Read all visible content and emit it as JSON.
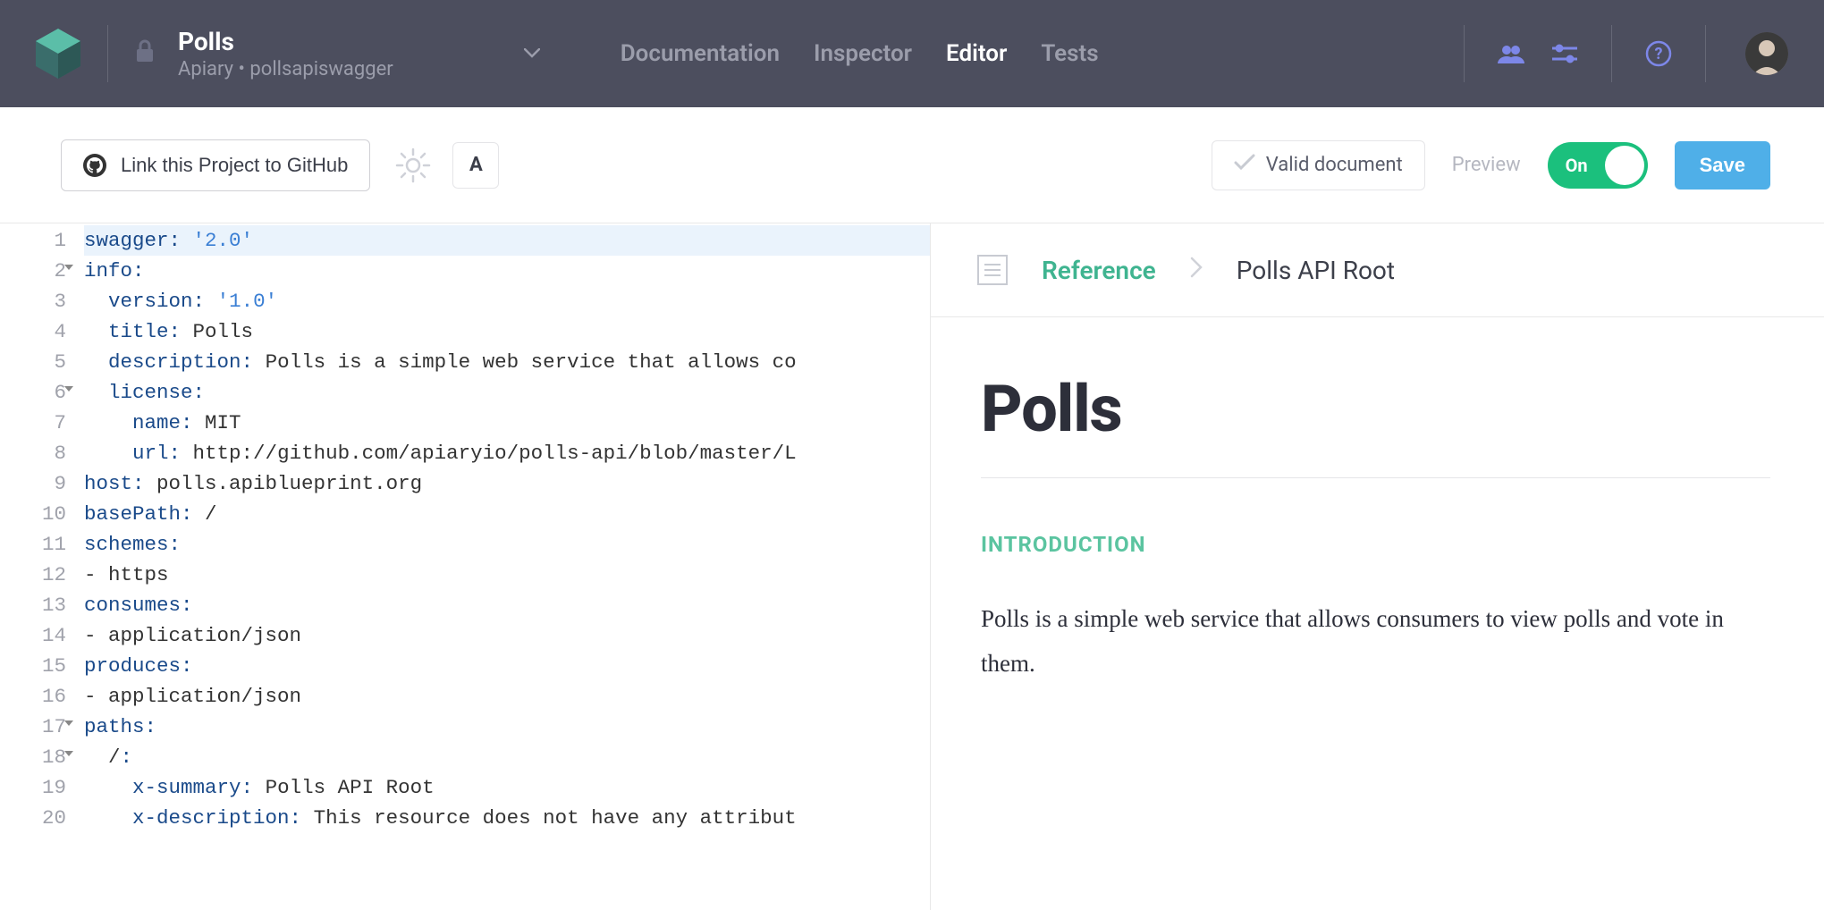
{
  "header": {
    "project_title": "Polls",
    "project_subtitle": "Apiary • pollsapiswagger",
    "tabs": [
      {
        "label": "Documentation",
        "active": false
      },
      {
        "label": "Inspector",
        "active": false
      },
      {
        "label": "Editor",
        "active": true
      },
      {
        "label": "Tests",
        "active": false
      }
    ]
  },
  "toolbar": {
    "github_label": "Link this Project to GitHub",
    "a_label": "A",
    "valid_label": "Valid document",
    "preview_label": "Preview",
    "toggle_label": "On",
    "save_label": "Save"
  },
  "editor": {
    "lines": [
      {
        "n": 1,
        "hl": true,
        "fold": false,
        "tokens": [
          [
            "key",
            "swagger"
          ],
          [
            "punct",
            ":"
          ],
          [
            "txt",
            " "
          ],
          [
            "str",
            "'2.0'"
          ]
        ]
      },
      {
        "n": 2,
        "fold": true,
        "tokens": [
          [
            "key",
            "info"
          ],
          [
            "punct",
            ":"
          ]
        ]
      },
      {
        "n": 3,
        "tokens": [
          [
            "txt",
            "  "
          ],
          [
            "key",
            "version"
          ],
          [
            "punct",
            ":"
          ],
          [
            "txt",
            " "
          ],
          [
            "str",
            "'1.0'"
          ]
        ]
      },
      {
        "n": 4,
        "tokens": [
          [
            "txt",
            "  "
          ],
          [
            "key",
            "title"
          ],
          [
            "punct",
            ":"
          ],
          [
            "txt",
            " Polls"
          ]
        ]
      },
      {
        "n": 5,
        "tokens": [
          [
            "txt",
            "  "
          ],
          [
            "key",
            "description"
          ],
          [
            "punct",
            ":"
          ],
          [
            "txt",
            " Polls is a simple web service that allows co"
          ]
        ]
      },
      {
        "n": 6,
        "fold": true,
        "tokens": [
          [
            "txt",
            "  "
          ],
          [
            "key",
            "license"
          ],
          [
            "punct",
            ":"
          ]
        ]
      },
      {
        "n": 7,
        "tokens": [
          [
            "txt",
            "    "
          ],
          [
            "key",
            "name"
          ],
          [
            "punct",
            ":"
          ],
          [
            "txt",
            " MIT"
          ]
        ]
      },
      {
        "n": 8,
        "tokens": [
          [
            "txt",
            "    "
          ],
          [
            "key",
            "url"
          ],
          [
            "punct",
            ":"
          ],
          [
            "txt",
            " http://github.com/apiaryio/polls-api/blob/master/L"
          ]
        ]
      },
      {
        "n": 9,
        "tokens": [
          [
            "key",
            "host"
          ],
          [
            "punct",
            ":"
          ],
          [
            "txt",
            " polls.apiblueprint.org"
          ]
        ]
      },
      {
        "n": 10,
        "tokens": [
          [
            "key",
            "basePath"
          ],
          [
            "punct",
            ":"
          ],
          [
            "txt",
            " /"
          ]
        ]
      },
      {
        "n": 11,
        "tokens": [
          [
            "key",
            "schemes"
          ],
          [
            "punct",
            ":"
          ]
        ]
      },
      {
        "n": 12,
        "tokens": [
          [
            "txt",
            "- https"
          ]
        ]
      },
      {
        "n": 13,
        "tokens": [
          [
            "key",
            "consumes"
          ],
          [
            "punct",
            ":"
          ]
        ]
      },
      {
        "n": 14,
        "tokens": [
          [
            "txt",
            "- application/json"
          ]
        ]
      },
      {
        "n": 15,
        "tokens": [
          [
            "key",
            "produces"
          ],
          [
            "punct",
            ":"
          ]
        ]
      },
      {
        "n": 16,
        "tokens": [
          [
            "txt",
            "- application/json"
          ]
        ]
      },
      {
        "n": 17,
        "fold": true,
        "tokens": [
          [
            "key",
            "paths"
          ],
          [
            "punct",
            ":"
          ]
        ]
      },
      {
        "n": 18,
        "fold": true,
        "tokens": [
          [
            "txt",
            "  /"
          ],
          [
            "punct",
            ":"
          ]
        ]
      },
      {
        "n": 19,
        "tokens": [
          [
            "txt",
            "    "
          ],
          [
            "key",
            "x-summary"
          ],
          [
            "punct",
            ":"
          ],
          [
            "txt",
            " Polls API Root"
          ]
        ]
      },
      {
        "n": 20,
        "tokens": [
          [
            "txt",
            "    "
          ],
          [
            "key",
            "x-description"
          ],
          [
            "punct",
            ":"
          ],
          [
            "txt",
            " This resource does not have any attribut"
          ]
        ]
      }
    ]
  },
  "preview": {
    "crumb_ref": "Reference",
    "crumb_current": "Polls API Root",
    "doc_title": "Polls",
    "section_label": "INTRODUCTION",
    "paragraph": "Polls is a simple web service that allows consumers to view polls and vote in them."
  }
}
